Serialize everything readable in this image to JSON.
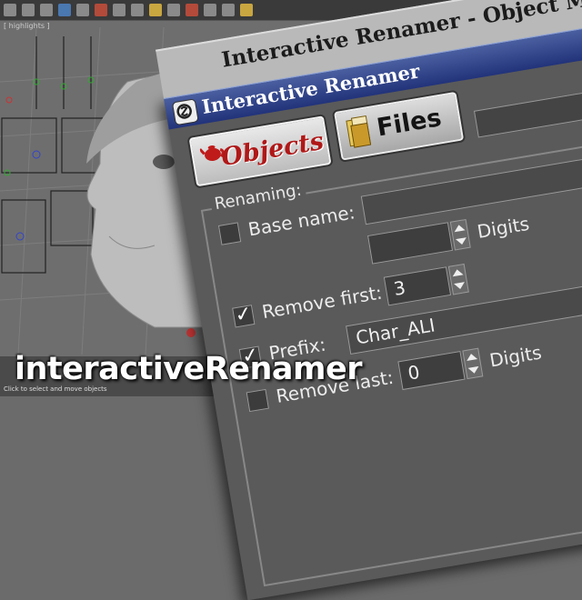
{
  "window": {
    "title": "Interactive Renamer - Object Mode",
    "titlebar_text": "Interactive Renamer"
  },
  "tabs": [
    {
      "label": "Objects",
      "icon": "teapot-icon",
      "selected": true
    },
    {
      "label": "Files",
      "icon": "folder-icon",
      "selected": false
    }
  ],
  "renaming": {
    "group_label": "Renaming:",
    "base_name": {
      "label": "Base name:",
      "checked": false,
      "value": ""
    },
    "digits_label": "Digits",
    "remove_first": {
      "label": "Remove first:",
      "checked": true,
      "value": "3"
    },
    "prefix": {
      "label": "Prefix:",
      "checked": true,
      "value": "Char_ALI"
    },
    "remove_last": {
      "label": "Remove last:",
      "checked": false,
      "value": "0"
    },
    "digits_label_2": "Digits"
  },
  "viewport": {
    "label": "[ highlights ]",
    "status": "Click to select and move objects"
  },
  "caption": "interactiveRenamer",
  "colors": {
    "titlebar": "#2b3d86",
    "dialog_bg": "#5a5a5a",
    "objects_label": "#b01818"
  }
}
